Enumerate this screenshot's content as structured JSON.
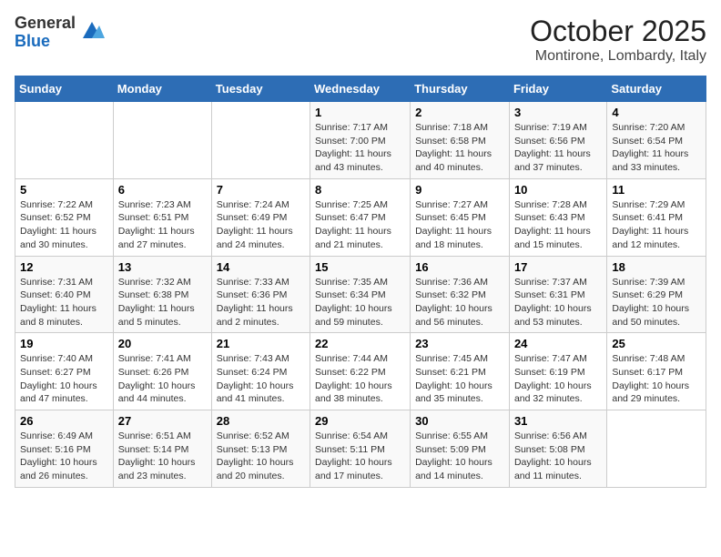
{
  "logo": {
    "general": "General",
    "blue": "Blue"
  },
  "title": "October 2025",
  "subtitle": "Montirone, Lombardy, Italy",
  "days_of_week": [
    "Sunday",
    "Monday",
    "Tuesday",
    "Wednesday",
    "Thursday",
    "Friday",
    "Saturday"
  ],
  "weeks": [
    [
      {
        "day": "",
        "sunrise": "",
        "sunset": "",
        "daylight": ""
      },
      {
        "day": "",
        "sunrise": "",
        "sunset": "",
        "daylight": ""
      },
      {
        "day": "",
        "sunrise": "",
        "sunset": "",
        "daylight": ""
      },
      {
        "day": "1",
        "sunrise": "Sunrise: 7:17 AM",
        "sunset": "Sunset: 7:00 PM",
        "daylight": "Daylight: 11 hours and 43 minutes."
      },
      {
        "day": "2",
        "sunrise": "Sunrise: 7:18 AM",
        "sunset": "Sunset: 6:58 PM",
        "daylight": "Daylight: 11 hours and 40 minutes."
      },
      {
        "day": "3",
        "sunrise": "Sunrise: 7:19 AM",
        "sunset": "Sunset: 6:56 PM",
        "daylight": "Daylight: 11 hours and 37 minutes."
      },
      {
        "day": "4",
        "sunrise": "Sunrise: 7:20 AM",
        "sunset": "Sunset: 6:54 PM",
        "daylight": "Daylight: 11 hours and 33 minutes."
      }
    ],
    [
      {
        "day": "5",
        "sunrise": "Sunrise: 7:22 AM",
        "sunset": "Sunset: 6:52 PM",
        "daylight": "Daylight: 11 hours and 30 minutes."
      },
      {
        "day": "6",
        "sunrise": "Sunrise: 7:23 AM",
        "sunset": "Sunset: 6:51 PM",
        "daylight": "Daylight: 11 hours and 27 minutes."
      },
      {
        "day": "7",
        "sunrise": "Sunrise: 7:24 AM",
        "sunset": "Sunset: 6:49 PM",
        "daylight": "Daylight: 11 hours and 24 minutes."
      },
      {
        "day": "8",
        "sunrise": "Sunrise: 7:25 AM",
        "sunset": "Sunset: 6:47 PM",
        "daylight": "Daylight: 11 hours and 21 minutes."
      },
      {
        "day": "9",
        "sunrise": "Sunrise: 7:27 AM",
        "sunset": "Sunset: 6:45 PM",
        "daylight": "Daylight: 11 hours and 18 minutes."
      },
      {
        "day": "10",
        "sunrise": "Sunrise: 7:28 AM",
        "sunset": "Sunset: 6:43 PM",
        "daylight": "Daylight: 11 hours and 15 minutes."
      },
      {
        "day": "11",
        "sunrise": "Sunrise: 7:29 AM",
        "sunset": "Sunset: 6:41 PM",
        "daylight": "Daylight: 11 hours and 12 minutes."
      }
    ],
    [
      {
        "day": "12",
        "sunrise": "Sunrise: 7:31 AM",
        "sunset": "Sunset: 6:40 PM",
        "daylight": "Daylight: 11 hours and 8 minutes."
      },
      {
        "day": "13",
        "sunrise": "Sunrise: 7:32 AM",
        "sunset": "Sunset: 6:38 PM",
        "daylight": "Daylight: 11 hours and 5 minutes."
      },
      {
        "day": "14",
        "sunrise": "Sunrise: 7:33 AM",
        "sunset": "Sunset: 6:36 PM",
        "daylight": "Daylight: 11 hours and 2 minutes."
      },
      {
        "day": "15",
        "sunrise": "Sunrise: 7:35 AM",
        "sunset": "Sunset: 6:34 PM",
        "daylight": "Daylight: 10 hours and 59 minutes."
      },
      {
        "day": "16",
        "sunrise": "Sunrise: 7:36 AM",
        "sunset": "Sunset: 6:32 PM",
        "daylight": "Daylight: 10 hours and 56 minutes."
      },
      {
        "day": "17",
        "sunrise": "Sunrise: 7:37 AM",
        "sunset": "Sunset: 6:31 PM",
        "daylight": "Daylight: 10 hours and 53 minutes."
      },
      {
        "day": "18",
        "sunrise": "Sunrise: 7:39 AM",
        "sunset": "Sunset: 6:29 PM",
        "daylight": "Daylight: 10 hours and 50 minutes."
      }
    ],
    [
      {
        "day": "19",
        "sunrise": "Sunrise: 7:40 AM",
        "sunset": "Sunset: 6:27 PM",
        "daylight": "Daylight: 10 hours and 47 minutes."
      },
      {
        "day": "20",
        "sunrise": "Sunrise: 7:41 AM",
        "sunset": "Sunset: 6:26 PM",
        "daylight": "Daylight: 10 hours and 44 minutes."
      },
      {
        "day": "21",
        "sunrise": "Sunrise: 7:43 AM",
        "sunset": "Sunset: 6:24 PM",
        "daylight": "Daylight: 10 hours and 41 minutes."
      },
      {
        "day": "22",
        "sunrise": "Sunrise: 7:44 AM",
        "sunset": "Sunset: 6:22 PM",
        "daylight": "Daylight: 10 hours and 38 minutes."
      },
      {
        "day": "23",
        "sunrise": "Sunrise: 7:45 AM",
        "sunset": "Sunset: 6:21 PM",
        "daylight": "Daylight: 10 hours and 35 minutes."
      },
      {
        "day": "24",
        "sunrise": "Sunrise: 7:47 AM",
        "sunset": "Sunset: 6:19 PM",
        "daylight": "Daylight: 10 hours and 32 minutes."
      },
      {
        "day": "25",
        "sunrise": "Sunrise: 7:48 AM",
        "sunset": "Sunset: 6:17 PM",
        "daylight": "Daylight: 10 hours and 29 minutes."
      }
    ],
    [
      {
        "day": "26",
        "sunrise": "Sunrise: 6:49 AM",
        "sunset": "Sunset: 5:16 PM",
        "daylight": "Daylight: 10 hours and 26 minutes."
      },
      {
        "day": "27",
        "sunrise": "Sunrise: 6:51 AM",
        "sunset": "Sunset: 5:14 PM",
        "daylight": "Daylight: 10 hours and 23 minutes."
      },
      {
        "day": "28",
        "sunrise": "Sunrise: 6:52 AM",
        "sunset": "Sunset: 5:13 PM",
        "daylight": "Daylight: 10 hours and 20 minutes."
      },
      {
        "day": "29",
        "sunrise": "Sunrise: 6:54 AM",
        "sunset": "Sunset: 5:11 PM",
        "daylight": "Daylight: 10 hours and 17 minutes."
      },
      {
        "day": "30",
        "sunrise": "Sunrise: 6:55 AM",
        "sunset": "Sunset: 5:09 PM",
        "daylight": "Daylight: 10 hours and 14 minutes."
      },
      {
        "day": "31",
        "sunrise": "Sunrise: 6:56 AM",
        "sunset": "Sunset: 5:08 PM",
        "daylight": "Daylight: 10 hours and 11 minutes."
      },
      {
        "day": "",
        "sunrise": "",
        "sunset": "",
        "daylight": ""
      }
    ]
  ]
}
